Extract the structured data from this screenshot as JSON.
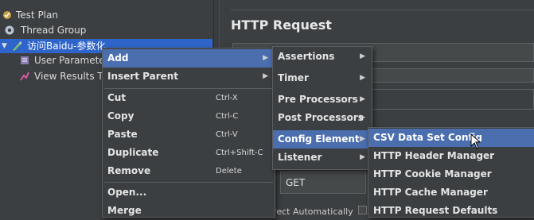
{
  "tree": {
    "items": [
      {
        "label": "Test Plan",
        "icon": "test-plan-icon"
      },
      {
        "label": "Thread Group",
        "icon": "gear-icon"
      },
      {
        "label": "访问Baidu-参数化",
        "icon": "sampler-pen-icon"
      },
      {
        "label": "User Paramete",
        "icon": "user-parameters-icon"
      },
      {
        "label": "View Results Tr",
        "icon": "view-results-icon"
      }
    ]
  },
  "panel": {
    "title": "HTTP Request",
    "method_value": "GET",
    "redirect_label": "irect Automatically"
  },
  "context_menu": {
    "items": [
      {
        "label": "Add",
        "submenu": true
      },
      {
        "label": "Insert Parent",
        "submenu": true
      },
      {
        "label": "Cut",
        "shortcut": "Ctrl-X"
      },
      {
        "label": "Copy",
        "shortcut": "Ctrl-C"
      },
      {
        "label": "Paste",
        "shortcut": "Ctrl-V"
      },
      {
        "label": "Duplicate",
        "shortcut": "Ctrl+Shift-C"
      },
      {
        "label": "Remove",
        "shortcut": "Delete"
      },
      {
        "label": "Open..."
      },
      {
        "label": "Merge"
      }
    ]
  },
  "add_menu": {
    "items": [
      {
        "label": "Assertions"
      },
      {
        "label": "Timer"
      },
      {
        "label": "Pre Processors"
      },
      {
        "label": "Post Processors"
      },
      {
        "label": "Config Element"
      },
      {
        "label": "Listener"
      }
    ]
  },
  "config_menu": {
    "items": [
      {
        "label": "CSV Data Set Config"
      },
      {
        "label": "HTTP Header Manager"
      },
      {
        "label": "HTTP Cookie Manager"
      },
      {
        "label": "HTTP Cache Manager"
      },
      {
        "label": "HTTP Request Defaults"
      }
    ]
  },
  "colors": {
    "background": "#3c3f41",
    "highlight": "#4b6eaf",
    "tree_selection": "#2f65ca"
  }
}
